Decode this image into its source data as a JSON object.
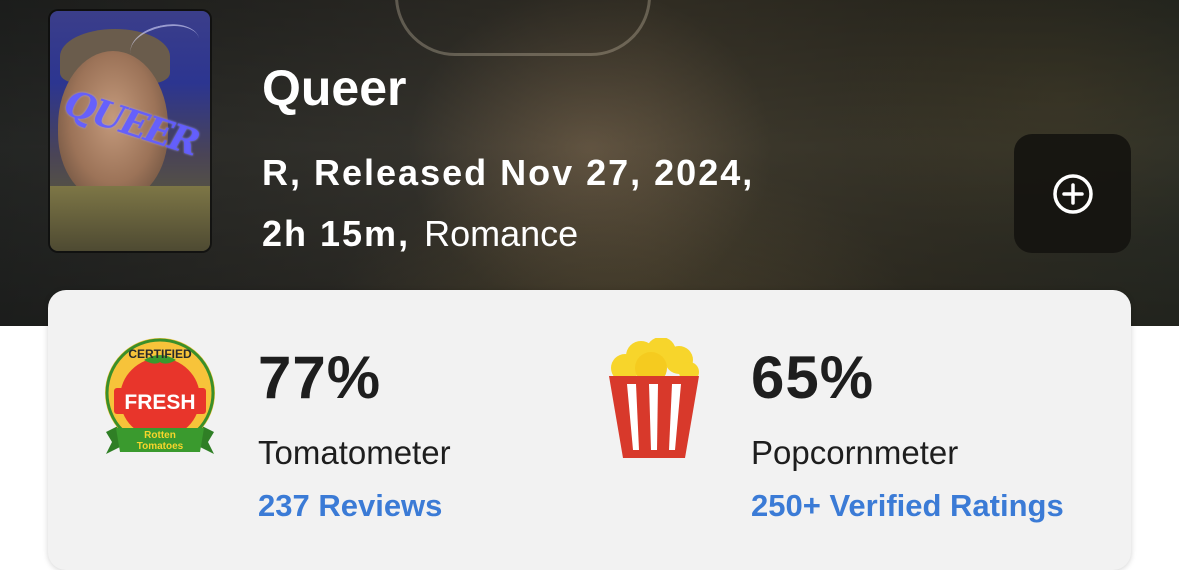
{
  "movie": {
    "title": "Queer",
    "rating_release": "R, Released Nov 27, 2024,",
    "runtime": "2h 15m,",
    "genre": "Romance",
    "poster_text": "QUEER"
  },
  "actions": {
    "add_icon": "plus-circle-icon"
  },
  "scores": {
    "tomatometer": {
      "value": "77%",
      "label": "Tomatometer",
      "link": "237 Reviews",
      "badge": {
        "top": "CERTIFIED",
        "middle": "FRESH",
        "bottom1": "Rotten",
        "bottom2": "Tomatoes"
      }
    },
    "popcornmeter": {
      "value": "65%",
      "label": "Popcornmeter",
      "link": "250+ Verified Ratings"
    }
  },
  "colors": {
    "link_blue": "#3b7bd6",
    "fresh_red": "#e8352b",
    "certified_yellow": "#f7c33a",
    "badge_green": "#3a9a2e",
    "popcorn_red": "#d8392b",
    "popcorn_yellow": "#f7d52b"
  }
}
